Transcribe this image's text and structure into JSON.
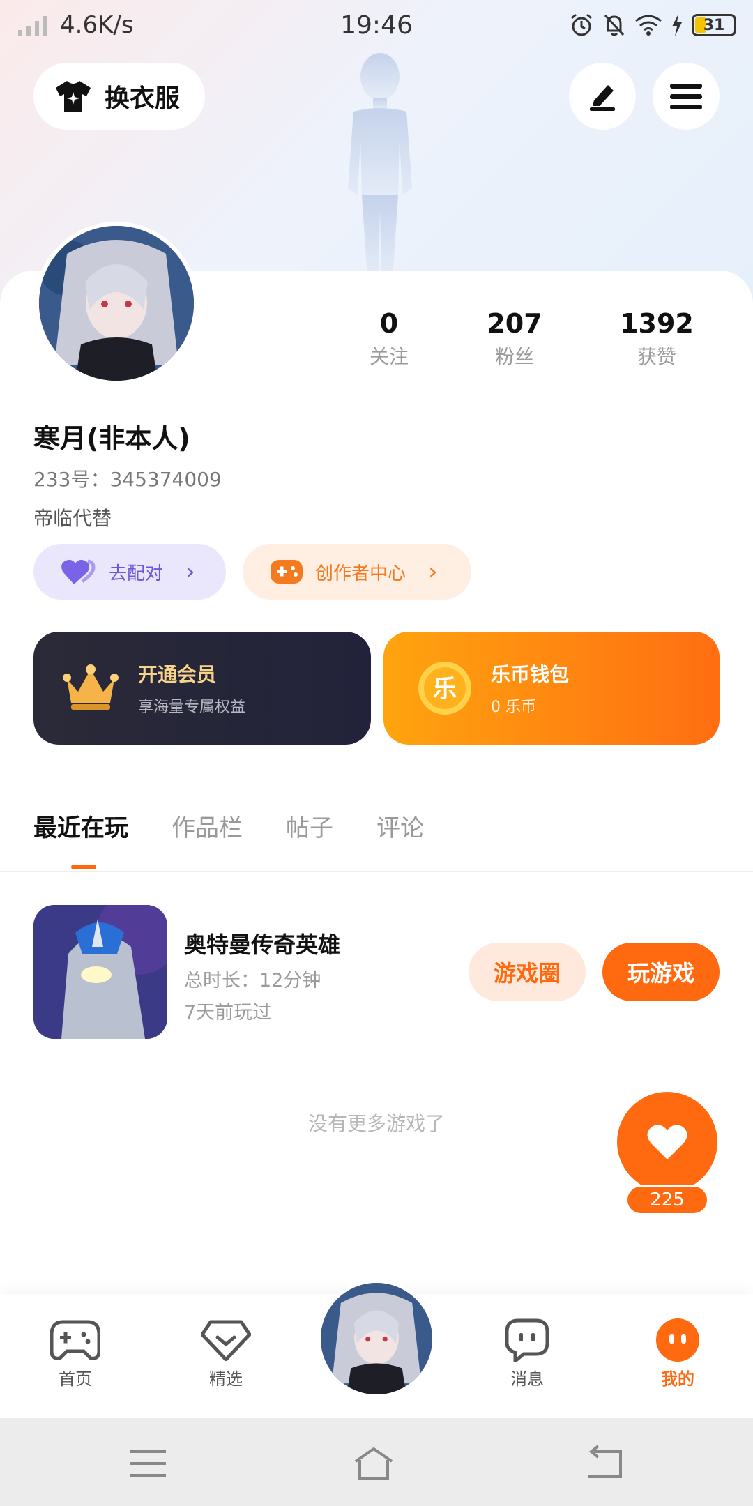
{
  "status_bar": {
    "network_speed": "4.6K/s",
    "time": "19:46",
    "battery": "31"
  },
  "header": {
    "outfit_label": "换衣服"
  },
  "profile": {
    "stats": [
      {
        "value": "0",
        "label": "关注"
      },
      {
        "value": "207",
        "label": "粉丝"
      },
      {
        "value": "1392",
        "label": "获赞"
      }
    ],
    "username": "寒月(非本人)",
    "id_text": "233号：345374009",
    "bio": "帝临代替"
  },
  "pills": {
    "match_label": "去配对",
    "creator_label": "创作者中心"
  },
  "vip": {
    "title": "开通会员",
    "subtitle": "享海量专属权益"
  },
  "wallet": {
    "title": "乐币钱包",
    "subtitle": "0 乐币",
    "coin_glyph": "乐"
  },
  "tabs": [
    {
      "label": "最近在玩",
      "active": true
    },
    {
      "label": "作品栏"
    },
    {
      "label": "帖子"
    },
    {
      "label": "评论"
    }
  ],
  "game": {
    "name": "奥特曼传奇英雄",
    "duration": "总时长：12分钟",
    "last_played": "7天前玩过",
    "circle_label": "游戏圈",
    "play_label": "玩游戏"
  },
  "empty_text": "没有更多游戏了",
  "like_count": "225",
  "bottom_nav": [
    {
      "label": "首页"
    },
    {
      "label": "精选"
    },
    {
      "label": "消息"
    },
    {
      "label": "我的"
    }
  ],
  "colors": {
    "accent": "#ff6a10",
    "purple": "#6c59d8"
  }
}
